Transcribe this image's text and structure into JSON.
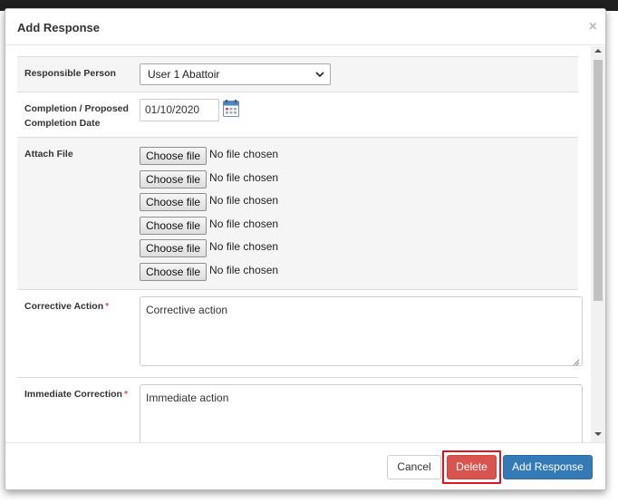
{
  "modal": {
    "title": "Add Response",
    "close_glyph": "×"
  },
  "form": {
    "responsible_person": {
      "label": "Responsible Person",
      "selected": "User 1 Abattoir"
    },
    "completion_date": {
      "label": "Completion / Proposed Completion Date",
      "value": "01/10/2020"
    },
    "attach_file": {
      "label": "Attach File",
      "button_label": "Choose file",
      "status": "No file chosen",
      "slots": [
        {
          "button": "Choose file",
          "status": "No file chosen"
        },
        {
          "button": "Choose file",
          "status": "No file chosen"
        },
        {
          "button": "Choose file",
          "status": "No file chosen"
        },
        {
          "button": "Choose file",
          "status": "No file chosen"
        },
        {
          "button": "Choose file",
          "status": "No file chosen"
        },
        {
          "button": "Choose file",
          "status": "No file chosen"
        }
      ]
    },
    "corrective_action": {
      "label": "Corrective Action",
      "required_mark": "*",
      "value": "Corrective action"
    },
    "immediate_correction": {
      "label": "Immediate Correction",
      "required_mark": "*",
      "value": "Immediate action"
    }
  },
  "footer": {
    "cancel_label": "Cancel",
    "delete_label": "Delete",
    "add_label": "Add Response"
  },
  "colors": {
    "primary": "#337ab7",
    "danger": "#d9534f",
    "highlight": "#e0141e",
    "required": "#d9534f"
  },
  "icons": {
    "close": "close-icon",
    "calendar": "calendar-icon",
    "dropdown": "chevron-down-icon"
  }
}
